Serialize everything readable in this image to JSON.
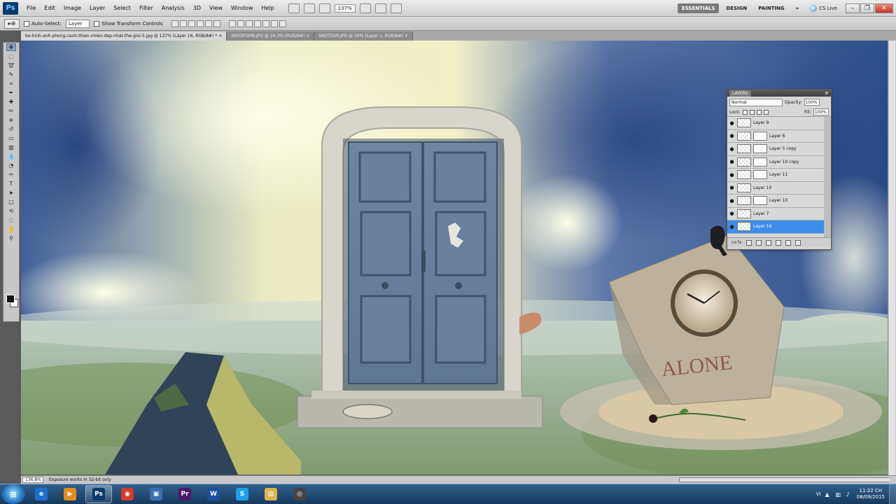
{
  "app": {
    "logo": "Ps",
    "zoom": "137%"
  },
  "menu": [
    "File",
    "Edit",
    "Image",
    "Layer",
    "Select",
    "Filter",
    "Analysis",
    "3D",
    "View",
    "Window",
    "Help"
  ],
  "workspace": {
    "essentials": "ESSENTIALS",
    "design": "DESIGN",
    "painting": "PAINTING",
    "more": "»",
    "cslive": "CS Live"
  },
  "window_buttons": {
    "minimize": "–",
    "restore": "❐",
    "close": "✕"
  },
  "options": {
    "tool_icon": "▸⊕",
    "auto_select_label": "Auto-Select:",
    "auto_select_value": "Layer",
    "transform_label": "Show Transform Controls"
  },
  "tabs": [
    "bo-hinh-anh-phong-canh-thien-nhien-dep-nhat-the-gioi-5.jpg @ 137% (Layer 16, RGB/8#) *  ×",
    "SREDFOMB.JPG @ 24,3% (RGB/8#)  ×",
    "SNDTDSR.JPG @ 30% (Layer 1, RGB/8#)  ×"
  ],
  "layers_panel": {
    "tab": "LAYERS",
    "menu": "≡",
    "blend_mode": "Normal",
    "opacity_label": "Opacity:",
    "opacity": "100%",
    "lock_label": "Lock:",
    "fill_label": "Fill:",
    "fill": "100%",
    "footer_link": "co fx",
    "layers": [
      {
        "name": "Layer 9",
        "mask": false,
        "selected": false
      },
      {
        "name": "Layer 6",
        "mask": true,
        "selected": false
      },
      {
        "name": "Layer 5 copy",
        "mask": true,
        "selected": false
      },
      {
        "name": "Layer 10 copy",
        "mask": true,
        "selected": false
      },
      {
        "name": "Layer 11",
        "mask": true,
        "selected": false
      },
      {
        "name": "Layer 10",
        "mask": false,
        "selected": false
      },
      {
        "name": "Layer 10",
        "mask": true,
        "selected": false
      },
      {
        "name": "Layer 7",
        "mask": false,
        "selected": false
      },
      {
        "name": "Layer 16",
        "mask": false,
        "selected": true
      }
    ]
  },
  "status": {
    "zoom": "136,8%",
    "doc": "Exposure works in 32-bit only"
  },
  "canvas_text": {
    "rock_word": "ALONE"
  },
  "taskbar": {
    "start": "⊞",
    "apps": [
      {
        "name": "ie",
        "glyph": "e",
        "color": "#1e6fd1",
        "open": false
      },
      {
        "name": "media",
        "glyph": "▶",
        "color": "#e68a1f",
        "open": false
      },
      {
        "name": "photoshop",
        "glyph": "Ps",
        "color": "#0b3a69",
        "open": true
      },
      {
        "name": "chrome",
        "glyph": "◉",
        "color": "#d23b2e",
        "open": false
      },
      {
        "name": "network",
        "glyph": "▣",
        "color": "#3a6fb0",
        "open": false
      },
      {
        "name": "premiere",
        "glyph": "Pr",
        "color": "#4b1a6e",
        "open": false
      },
      {
        "name": "word",
        "glyph": "W",
        "color": "#1f4f9e",
        "open": false
      },
      {
        "name": "skype",
        "glyph": "S",
        "color": "#1aa0e8",
        "open": false
      },
      {
        "name": "explorer",
        "glyph": "▤",
        "color": "#d9b447",
        "open": false
      },
      {
        "name": "media2",
        "glyph": "◎",
        "color": "#444",
        "open": false
      }
    ],
    "lang": "VI",
    "time": "11:22 CH",
    "date": "08/09/2015"
  }
}
